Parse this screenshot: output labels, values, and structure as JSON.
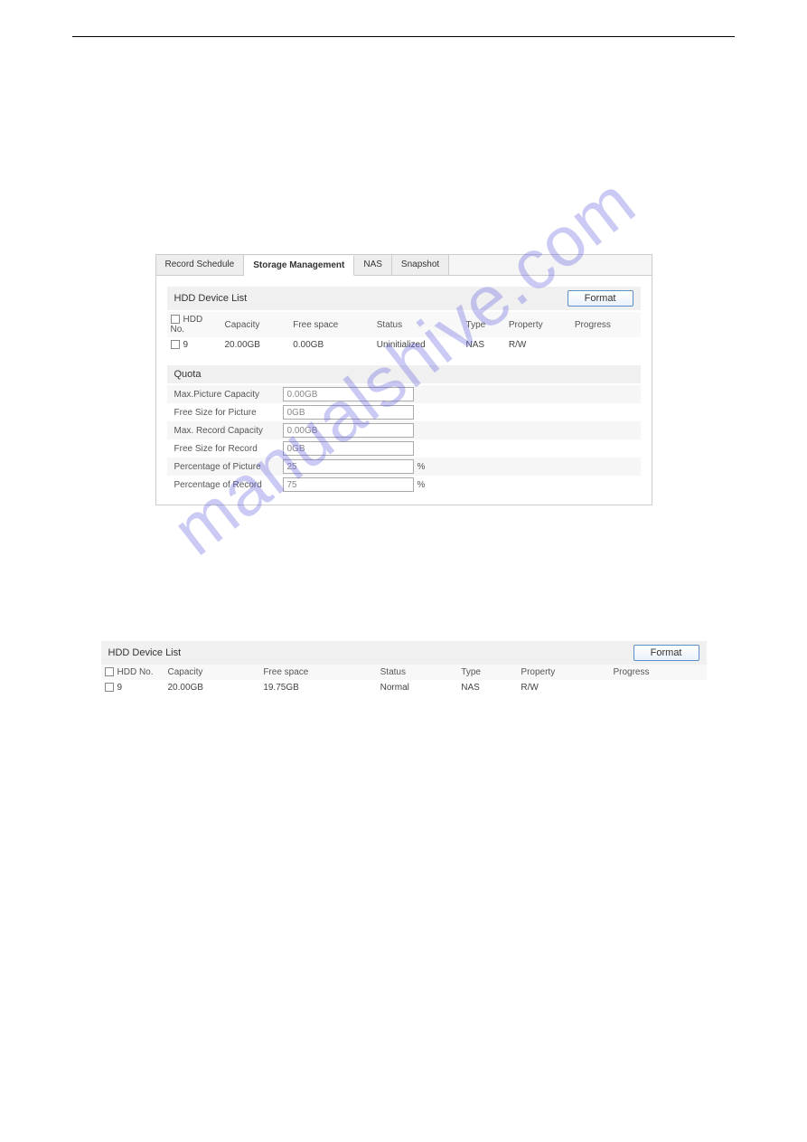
{
  "watermark": "manualshive.com",
  "tabs": {
    "items": [
      "Record Schedule",
      "Storage Management",
      "NAS",
      "Snapshot"
    ],
    "active_index": 1
  },
  "panel1": {
    "hdd_list_title": "HDD Device List",
    "format_label": "Format",
    "columns": {
      "hdd_no": "HDD No.",
      "capacity": "Capacity",
      "free_space": "Free space",
      "status": "Status",
      "type": "Type",
      "property": "Property",
      "progress": "Progress"
    },
    "row": {
      "no": "9",
      "capacity": "20.00GB",
      "free_space": "0.00GB",
      "status": "Uninitialized",
      "type": "NAS",
      "property": "R/W",
      "progress": ""
    },
    "quota_title": "Quota",
    "quota": {
      "max_picture_label": "Max.Picture Capacity",
      "max_picture_value": "0.00GB",
      "free_picture_label": "Free Size for Picture",
      "free_picture_value": "0GB",
      "max_record_label": "Max. Record Capacity",
      "max_record_value": "0.00GB",
      "free_record_label": "Free Size for Record",
      "free_record_value": "0GB",
      "pct_picture_label": "Percentage of Picture",
      "pct_picture_value": "25",
      "pct_record_label": "Percentage of Record",
      "pct_record_value": "75",
      "pct_unit": "%"
    }
  },
  "panel2": {
    "hdd_list_title": "HDD Device List",
    "format_label": "Format",
    "columns": {
      "hdd_no": "HDD No.",
      "capacity": "Capacity",
      "free_space": "Free space",
      "status": "Status",
      "type": "Type",
      "property": "Property",
      "progress": "Progress"
    },
    "row": {
      "no": "9",
      "capacity": "20.00GB",
      "free_space": "19.75GB",
      "status": "Normal",
      "type": "NAS",
      "property": "R/W",
      "progress": ""
    }
  }
}
